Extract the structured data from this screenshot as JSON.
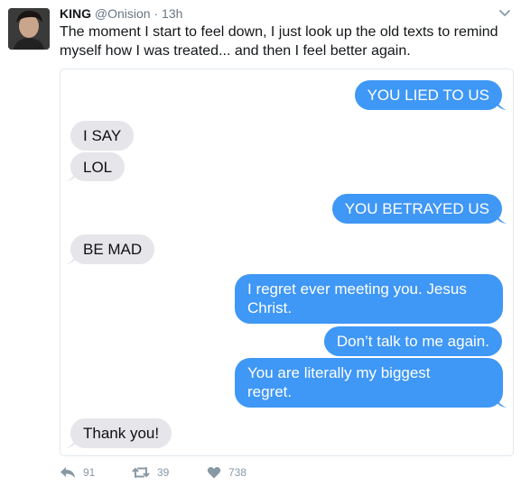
{
  "tweet": {
    "display_name": "KING",
    "handle": "@Onision",
    "separator": "·",
    "time": "13h",
    "text": "The moment I start to feel down, I just look up the old texts to remind myself how I was treated... and then I feel better again."
  },
  "messages": [
    {
      "from": "me",
      "text": "YOU LIED TO US"
    },
    {
      "from": "them",
      "text": "I SAY"
    },
    {
      "from": "them",
      "text": "LOL"
    },
    {
      "from": "me",
      "text": "YOU BETRAYED US"
    },
    {
      "from": "them",
      "text": "BE MAD"
    },
    {
      "from": "me",
      "line1": "I regret ever meeting you. Jesus",
      "line2": "Christ."
    },
    {
      "from": "me",
      "text": "Don’t talk to me again."
    },
    {
      "from": "me",
      "line1": "You are literally my biggest",
      "line2": "regret."
    },
    {
      "from": "them",
      "text": "Thank you!"
    }
  ],
  "actions": {
    "reply_count": "91",
    "retweet_count": "39",
    "like_count": "738"
  },
  "icons": {
    "reply": "reply-icon",
    "retweet": "retweet-icon",
    "like": "heart-icon",
    "menu": "chevron-down-icon"
  },
  "colors": {
    "outgoing_bubble": "#3f97f6",
    "incoming_bubble": "#e5e5ea",
    "action_gray": "#8899a6"
  }
}
